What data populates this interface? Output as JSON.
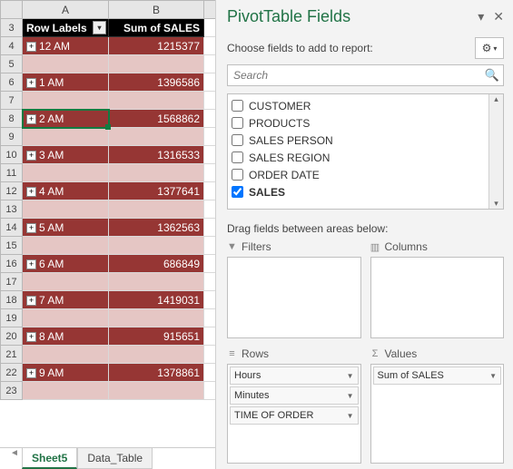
{
  "pivot_headers": {
    "row_labels": "Row Labels",
    "sum_of_sales": "Sum of SALES"
  },
  "columns": [
    "A",
    "B"
  ],
  "rows": [
    {
      "n": 3,
      "type": "header"
    },
    {
      "n": 4,
      "type": "band",
      "label": "12 AM",
      "value": "1215377"
    },
    {
      "n": 5,
      "type": "spacer"
    },
    {
      "n": 6,
      "type": "band",
      "label": "1 AM",
      "value": "1396586"
    },
    {
      "n": 7,
      "type": "spacer"
    },
    {
      "n": 8,
      "type": "band",
      "label": "2 AM",
      "value": "1568862",
      "selected": true
    },
    {
      "n": 9,
      "type": "spacer"
    },
    {
      "n": 10,
      "type": "band",
      "label": "3 AM",
      "value": "1316533"
    },
    {
      "n": 11,
      "type": "spacer"
    },
    {
      "n": 12,
      "type": "band",
      "label": "4 AM",
      "value": "1377641"
    },
    {
      "n": 13,
      "type": "spacer"
    },
    {
      "n": 14,
      "type": "band",
      "label": "5 AM",
      "value": "1362563"
    },
    {
      "n": 15,
      "type": "spacer"
    },
    {
      "n": 16,
      "type": "band",
      "label": "6 AM",
      "value": "686849"
    },
    {
      "n": 17,
      "type": "spacer"
    },
    {
      "n": 18,
      "type": "band",
      "label": "7 AM",
      "value": "1419031"
    },
    {
      "n": 19,
      "type": "spacer"
    },
    {
      "n": 20,
      "type": "band",
      "label": "8 AM",
      "value": "915651"
    },
    {
      "n": 21,
      "type": "spacer"
    },
    {
      "n": 22,
      "type": "band",
      "label": "9 AM",
      "value": "1378861"
    },
    {
      "n": 23,
      "type": "spacer"
    }
  ],
  "tabs": {
    "active": "Sheet5",
    "other": "Data_Table"
  },
  "pane": {
    "title": "PivotTable Fields",
    "choose_label": "Choose fields to add to report:",
    "search_placeholder": "Search",
    "fields": [
      {
        "label": "CUSTOMER",
        "checked": false
      },
      {
        "label": "PRODUCTS",
        "checked": false
      },
      {
        "label": "SALES PERSON",
        "checked": false
      },
      {
        "label": "SALES REGION",
        "checked": false
      },
      {
        "label": "ORDER DATE",
        "checked": false
      },
      {
        "label": "SALES",
        "checked": true
      }
    ],
    "drag_label": "Drag fields between areas below:",
    "areas": {
      "filters": {
        "title": "Filters",
        "items": []
      },
      "columns": {
        "title": "Columns",
        "items": []
      },
      "rows": {
        "title": "Rows",
        "items": [
          "Hours",
          "Minutes",
          "TIME OF ORDER"
        ]
      },
      "values": {
        "title": "Values",
        "items": [
          "Sum of SALES"
        ]
      }
    }
  }
}
